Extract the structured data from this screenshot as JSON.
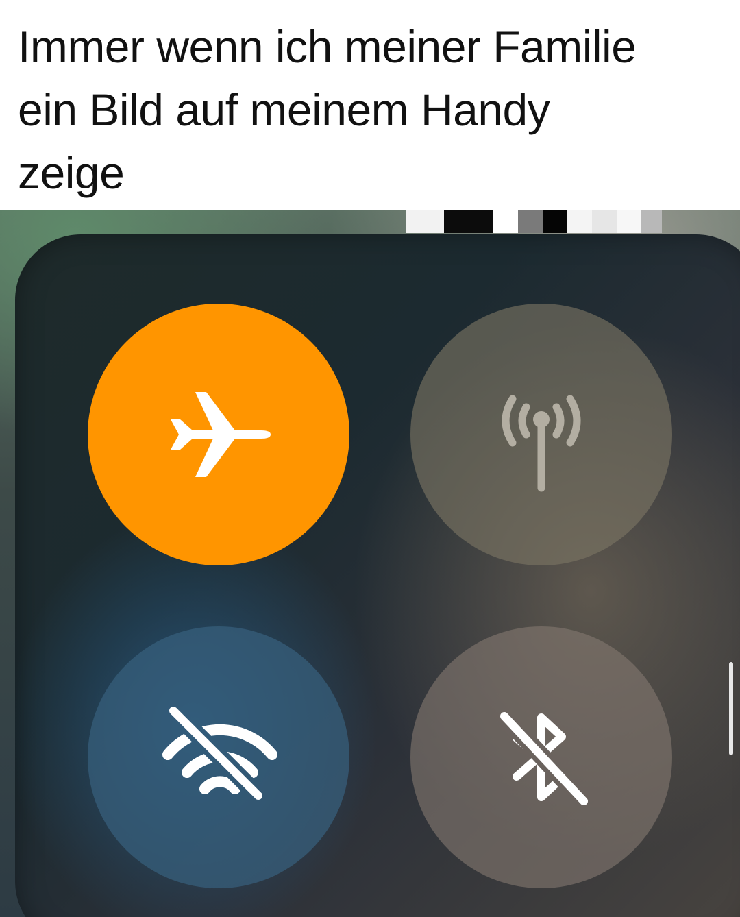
{
  "caption": {
    "text": "Immer wenn ich meiner Familie\nein Bild auf meinem Handy\nzeige"
  },
  "control_center": {
    "airplane_mode": {
      "icon": "airplane-icon",
      "state": "on",
      "color": "#ff9500"
    },
    "cellular_data": {
      "icon": "cellular-antenna-icon",
      "state": "off",
      "color": "#6b6558"
    },
    "wifi": {
      "icon": "wifi-off-icon",
      "state": "off",
      "color": "#30556e"
    },
    "bluetooth": {
      "icon": "bluetooth-off-icon",
      "state": "off",
      "color": "#6d6661"
    }
  }
}
